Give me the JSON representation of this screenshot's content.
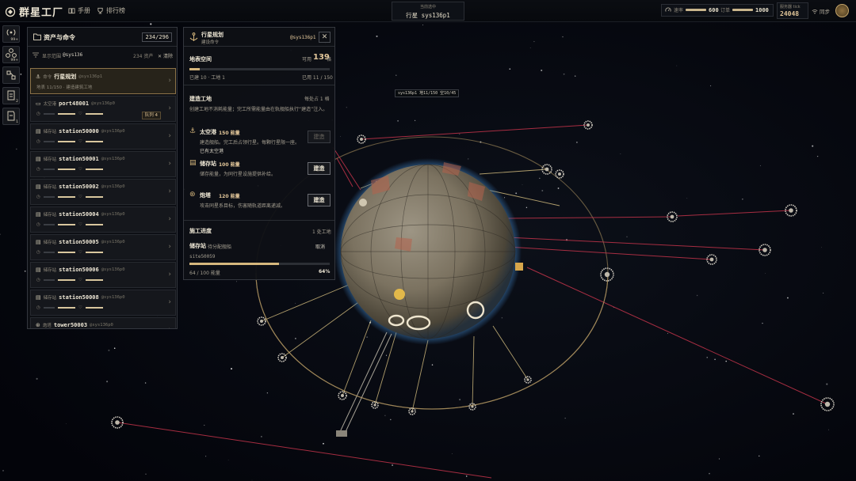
{
  "header": {
    "app_title": "群星工厂",
    "nav": [
      {
        "label": "手册",
        "icon": "book-icon"
      },
      {
        "label": "排行榜",
        "icon": "trophy-icon"
      }
    ],
    "selection": {
      "caption": "当前选中",
      "value": "行星 sys136p1"
    },
    "resources": [
      {
        "label": "速率",
        "value": "600",
        "icon": "gauge-icon"
      },
      {
        "label": "订单",
        "value": "1000"
      }
    ],
    "server": {
      "caption": "服务器 tick",
      "value": "24048"
    },
    "sync_label": "同步"
  },
  "rail": [
    {
      "icon": "signal-icon",
      "badge": "99+"
    },
    {
      "icon": "network-icon",
      "badge": "99+"
    },
    {
      "icon": "nodes-icon",
      "badge": ""
    },
    {
      "icon": "task-icon",
      "badge": "2"
    },
    {
      "icon": "log-icon",
      "badge": "1"
    }
  ],
  "assets": {
    "title": "资产与命令",
    "count": "234/296",
    "filter_label": "显示范围",
    "filter_scope": "@sys136",
    "filter_count": "234 资产",
    "filter_clear": "清除",
    "items": [
      {
        "type": "命令",
        "name": "行星规划",
        "owner": "@sys136p1",
        "sub": "地表 11/150 · 建造建筑工地",
        "selected": true
      },
      {
        "type": "太空港",
        "name": "port48001",
        "owner": "@sys136p0",
        "queue": "队列 4"
      },
      {
        "type": "储存站",
        "name": "station50000",
        "owner": "@sys136p0"
      },
      {
        "type": "储存站",
        "name": "station50001",
        "owner": "@sys136p0"
      },
      {
        "type": "储存站",
        "name": "station50002",
        "owner": "@sys136p0"
      },
      {
        "type": "储存站",
        "name": "station50004",
        "owner": "@sys136p0"
      },
      {
        "type": "储存站",
        "name": "station50005",
        "owner": "@sys136p0"
      },
      {
        "type": "储存站",
        "name": "station50006",
        "owner": "@sys136p0"
      },
      {
        "type": "储存站",
        "name": "station50008",
        "owner": "@sys136p0"
      },
      {
        "type": "炮塔",
        "name": "tower50003",
        "owner": "@sys136p0"
      }
    ]
  },
  "plan": {
    "title": "行星规划",
    "subtitle": "建设命令",
    "owner": "@sys136p1",
    "close_label": "✕",
    "surface": {
      "title": "地表空间",
      "available_label": "可用",
      "available": "139",
      "unit": "格",
      "built": "已建 10 · 工地 1",
      "used": "已用 11 / 150",
      "used_fraction": 0.073
    },
    "site": {
      "title": "建造工地",
      "per_site": "每处占 1 格",
      "desc": "创建工地不消耗能量；完工所需能量由在轨舰船执行“建造”注入。"
    },
    "buildings": [
      {
        "icon": "anchor-icon",
        "name": "太空港",
        "cost": "150 能量",
        "desc": "建造舰船。完工后占领行星。每颗行星限一座。",
        "note": "已有太空港",
        "button": "建造",
        "enabled": false
      },
      {
        "icon": "storage-icon",
        "name": "储存站",
        "cost": "100 能量",
        "desc": "储存能量，为同行星设施提供补给。",
        "note": "",
        "button": "建造",
        "enabled": true
      },
      {
        "icon": "turret-icon",
        "name": "炮塔",
        "cost": "120 能量",
        "desc": "攻击同星系目标，伤害随轨道距离递减。",
        "note": "",
        "button": "建造",
        "enabled": true
      }
    ],
    "progress": {
      "title": "施工进度",
      "count": "1 处工地",
      "item_name": "储存站",
      "item_status": "待分配舰船",
      "cancel": "取消",
      "site_id": "site50059",
      "energy": "64 / 100 能量",
      "percent": "64%",
      "fraction": 0.64
    }
  },
  "map": {
    "planet_tooltip": "sys136p1 地11/150 空10/45"
  },
  "colors": {
    "accent": "#d6b77d",
    "panel": "#0e1015",
    "orbit": "#b79a64",
    "laser": "#c3344a"
  }
}
